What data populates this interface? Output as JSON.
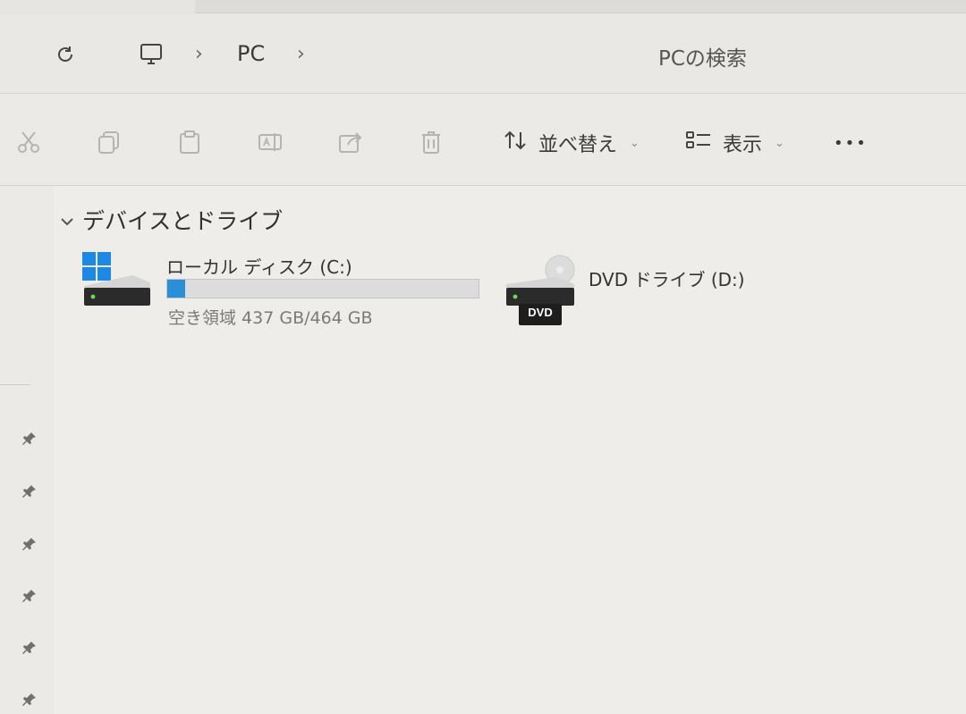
{
  "address_bar": {
    "breadcrumb": [
      "PC"
    ],
    "search_placeholder": "PCの検索"
  },
  "toolbar": {
    "sort_label": "並べ替え",
    "view_label": "表示",
    "more_label": "•••"
  },
  "section": {
    "title": "デバイスとドライブ"
  },
  "drives": [
    {
      "name": "ローカル ディスク (C:)",
      "free_text": "空き領域 437 GB/464 GB",
      "usage_fraction": 0.058
    },
    {
      "name": "DVD ドライブ (D:)",
      "badge": "DVD"
    }
  ],
  "colors": {
    "accent": "#2a8fd6",
    "windows_blue": "#1e88e5"
  },
  "icons": {
    "refresh": "refresh-icon",
    "this_pc": "monitor-icon",
    "cut": "scissors-icon",
    "copy": "copy-icon",
    "paste": "clipboard-icon",
    "rename": "rename-icon",
    "share": "share-icon",
    "delete": "trash-icon",
    "sort": "sort-icon",
    "view": "view-list-icon",
    "pin": "pin-icon"
  }
}
